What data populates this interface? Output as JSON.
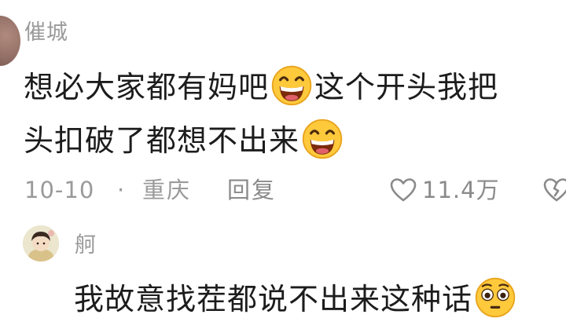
{
  "comment": {
    "username": "催城",
    "line1_part1": "想必大家都有妈吧",
    "line1_part2": "这个开头我把",
    "line2_part1": "头扣破了都想不出来",
    "emoji": "grinning-squinting-face",
    "time": "10-10",
    "separator": "·",
    "location": "重庆",
    "reply_label": "回复",
    "like_count": "11.4万"
  },
  "reply": {
    "username": "舸",
    "text": "我故意找茬都说不出来这种话",
    "emoji": "flushed-face"
  },
  "icons": {
    "like": "heart-outline-icon",
    "dislike": "broken-heart-icon"
  },
  "colors": {
    "text": "#1c1c1c",
    "meta": "#9a9a9a",
    "emoji_yellow": "#ffc93c",
    "emoji_mouth": "#7a2a0c"
  }
}
